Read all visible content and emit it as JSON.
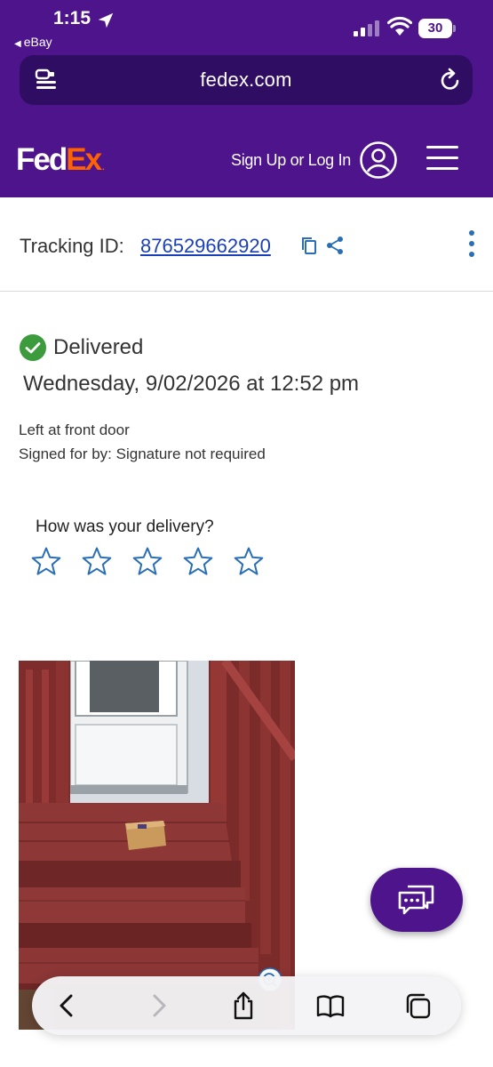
{
  "status_bar": {
    "time": "1:15",
    "back_app": "eBay",
    "battery": "30"
  },
  "browser": {
    "url": "fedex.com"
  },
  "nav": {
    "logo_fed": "Fed",
    "logo_ex": "Ex",
    "logo_dot": ".",
    "signup_label": "Sign Up or Log In"
  },
  "tracking": {
    "label": "Tracking ID:",
    "id": "876529662920"
  },
  "delivery": {
    "status": "Delivered",
    "date": "Wednesday, 9/02/2026 at 12:52 pm",
    "left_at": "Left at front door",
    "signed_for": "Signed for by: Signature not required"
  },
  "rating": {
    "question": "How was your delivery?",
    "stars": 5,
    "filled": 0
  },
  "colors": {
    "brand_purple": "#4d148c",
    "brand_orange": "#ff6200",
    "link_blue": "#1a3fb8",
    "success_green": "#3c9b3c",
    "star_blue": "#2a6fb5"
  },
  "icons": [
    "location-arrow-icon",
    "signal-icon",
    "wifi-icon",
    "battery-icon",
    "page-menu-icon",
    "reload-icon",
    "user-icon",
    "hamburger-icon",
    "copy-icon",
    "share-icon",
    "more-vertical-icon",
    "check-circle-icon",
    "star-icon",
    "zoom-icon",
    "chat-icon",
    "back-icon",
    "forward-icon",
    "share-sheet-icon",
    "bookmarks-icon",
    "tabs-icon"
  ]
}
